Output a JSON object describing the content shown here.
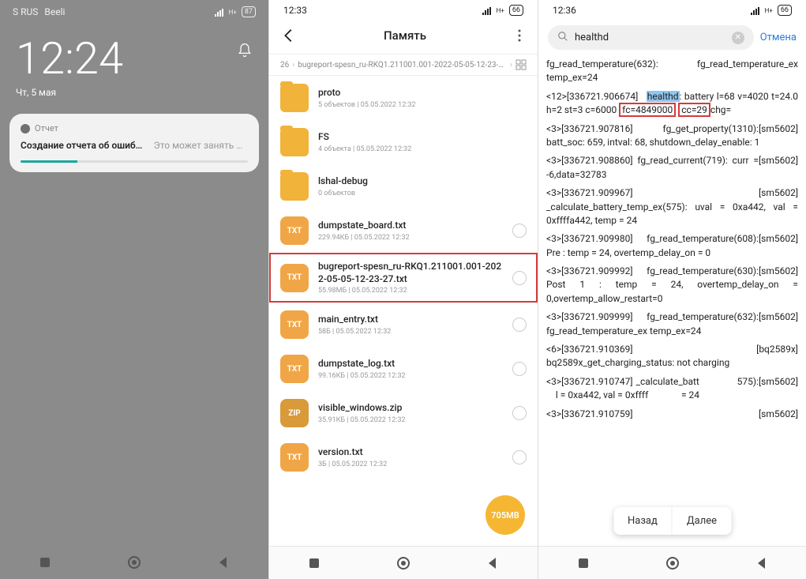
{
  "phone1": {
    "status_left": [
      "S RUS",
      "Beeli"
    ],
    "battery": "87",
    "clock": "12:24",
    "date": "Чт, 5 мая",
    "card": {
      "app": "Отчет",
      "title": "Создание отчета об ошибке…",
      "subtitle": "Это может занять не…"
    }
  },
  "phone2": {
    "time": "12:33",
    "battery": "66",
    "title": "Память",
    "breadcrumb": [
      "26",
      "bugreport-spesn_ru-RKQ1.211001.001-2022-05-05-12-23-27"
    ],
    "rows": [
      {
        "kind": "folder",
        "name": "proto",
        "meta": "5 объектов | 05.05.2022 12:32",
        "sel": false
      },
      {
        "kind": "folder",
        "name": "FS",
        "meta": "4 объекта | 05.05.2022 12:32",
        "sel": false
      },
      {
        "kind": "folder",
        "name": "lshal-debug",
        "meta": "0 объектов",
        "sel": false
      },
      {
        "kind": "txt",
        "name": "dumpstate_board.txt",
        "meta": "229.94КБ | 05.05.2022 12:32",
        "sel": true
      },
      {
        "kind": "txt",
        "name": "bugreport-spesn_ru-RKQ1.211001.001-2022-05-05-12-23-27.txt",
        "meta": "55.98МБ | 05.05.2022 12:32",
        "sel": true,
        "hl": true
      },
      {
        "kind": "txt",
        "name": "main_entry.txt",
        "meta": "58Б | 05.05.2022 12:32",
        "sel": true
      },
      {
        "kind": "txt",
        "name": "dumpstate_log.txt",
        "meta": "99.16КБ | 05.05.2022 12:32",
        "sel": true
      },
      {
        "kind": "zip",
        "name": "visible_windows.zip",
        "meta": "35.91КБ | 05.05.2022 12:32",
        "sel": true
      },
      {
        "kind": "txt",
        "name": "version.txt",
        "meta": "3Б | 05.05.2022 12:32",
        "sel": true
      }
    ],
    "fab": "705MB"
  },
  "phone3": {
    "time": "12:36",
    "battery": "66",
    "search": "healthd",
    "cancel": "Отмена",
    "nav_prev": "Назад",
    "nav_next": "Далее",
    "log": {
      "l1": "fg_read_temperature(632): fg_read_temperature_ex temp_ex=24",
      "l2a": "<12>[336721.906674]",
      "l2_hl": "healthd",
      "l2b": ": battery l=68 v=4020 t=24.0 h=2 st=3 c=6000",
      "l2_box1": "fc=4849000",
      "l2_box2": "cc=29",
      "l2c": "chg=",
      "l3tag": "[sm5602]",
      "l3": "<3>[336721.907816] fg_get_property(1310): batt_soc: 659, intval: 68, shutdown_delay_enable: 1",
      "l4": "<3>[336721.908860] fg_read_current(719): curr = -6,data=32783",
      "l5": "<3>[336721.909967] _calculate_battery_temp_ex(575): uval = 0xa442, val = 0xffffa442, temp = 24",
      "l6": "<3>[336721.909980] fg_read_temperature(608): Pre : temp = 24, overtemp_delay_on = 0",
      "l7": "<3>[336721.909992] fg_read_temperature(630): Post 1 : temp = 24, overtemp_delay_on = 0,overtemp_allow_restart=0",
      "l8": "<3>[336721.909999] fg_read_temperature(632): fg_read_temperature_ex temp_ex=24",
      "l9tag": "[bq2589x]",
      "l9": "<6>[336721.910369] bq2589x_get_charging_status: not charging",
      "l10a": "<3>[336721.910747] _calculate_batt",
      "l10b": "575): ",
      "l10c": "l = 0xa442, val = 0xffff",
      "l10d": "= 24",
      "l11": "<3>[336721.910759]"
    }
  }
}
